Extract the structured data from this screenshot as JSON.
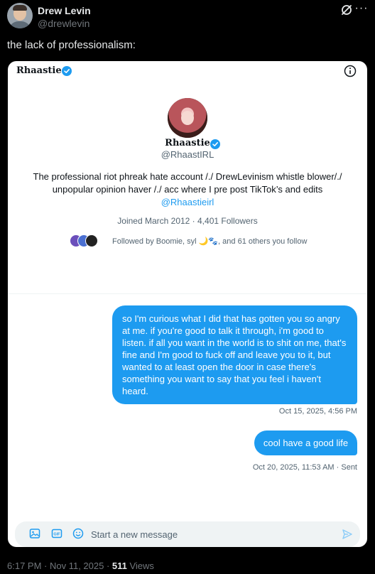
{
  "tweet": {
    "author_name": "Drew Levin",
    "author_handle": "@drewlevin",
    "text": "the lack of professionalism:",
    "timestamp": "6:17 PM · Nov 11, 2025 · ",
    "views_count": "511",
    "views_label": " Views"
  },
  "screenshot": {
    "header_name": "Rhaastie",
    "profile": {
      "name": "Rhaastie",
      "handle": "@RhaastIRL",
      "bio_line1": "The professional riot phreak hate account /./ DrewLevinism whistle blower/./",
      "bio_line2": "unpopular opinion haver /./ acc where I pre post TikTok’s and edits",
      "bio_link": "@Rhaastieirl",
      "joined": "Joined March 2012 · 4,401 Followers",
      "followed_by": "Followed by Boomie, syl 🌙🐾, and 61 others you follow"
    },
    "messages": [
      {
        "text": "so I'm curious what I did that has gotten you so angry at me. if you're good to talk it through, i'm good to listen. if all you want in the world is to shit on me, that's fine and I'm good to fuck off and leave you to it, but wanted to at least open the door in case there's something you want to say that you feel i haven't heard.",
        "meta": "Oct 15, 2025, 4:56 PM"
      },
      {
        "text": "cool have a good life",
        "meta": "Oct 20, 2025, 11:53 AM · Sent"
      }
    ],
    "composer_placeholder": "Start a new message",
    "composer_icons": [
      "image-icon",
      "gif-icon",
      "emoji-icon",
      "send-icon"
    ]
  },
  "colors": {
    "background": "#000000",
    "accent": "#1d9bf0",
    "muted": "#71767b"
  }
}
